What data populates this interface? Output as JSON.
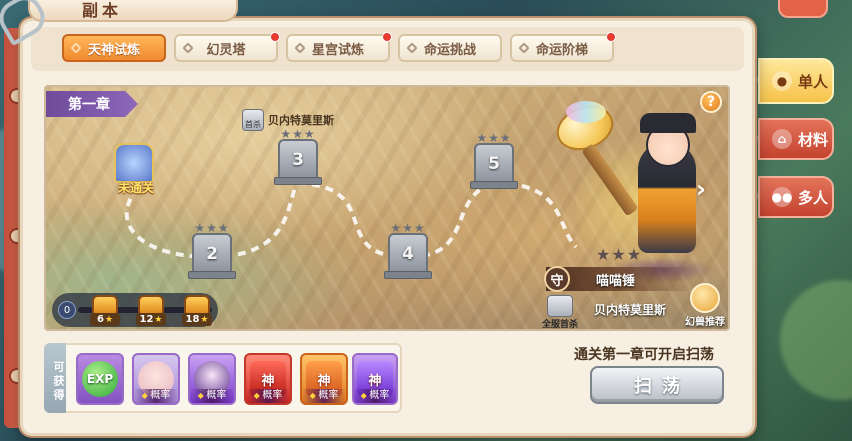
{
  "window": {
    "title": "副本"
  },
  "tabs": [
    {
      "label": "天神试炼",
      "active": true,
      "red_dot": false
    },
    {
      "label": "幻灵塔",
      "active": false,
      "red_dot": true
    },
    {
      "label": "星宫试炼",
      "active": false,
      "red_dot": true
    },
    {
      "label": "命运挑战",
      "active": false,
      "red_dot": false
    },
    {
      "label": "命运阶梯",
      "active": false,
      "red_dot": true
    }
  ],
  "map": {
    "chapter": "第一章",
    "help_symbol": "?",
    "first_kill_name": "贝内特莫里斯",
    "first_kill_badge": "首杀",
    "current_stage_label": "未通关",
    "stages": [
      "2",
      "3",
      "4",
      "5"
    ],
    "next_arrow": "›"
  },
  "boss": {
    "guard_badge": "守",
    "name": "喵喵锤",
    "stars": "★★★",
    "all_kill_label": "全服首杀",
    "recommended_player": "贝内特莫里斯",
    "pet_recommend": "幻兽推荐"
  },
  "progress": {
    "current": "0",
    "chests": [
      {
        "req": "6"
      },
      {
        "req": "12"
      },
      {
        "req": "18"
      }
    ]
  },
  "side_tabs": [
    {
      "label": "单人",
      "icon": "person-icon",
      "active": true
    },
    {
      "label": "材料",
      "icon": "material-bag-icon",
      "active": false
    },
    {
      "label": "多人",
      "icon": "group-icon",
      "active": false
    }
  ],
  "rewards": {
    "label": "可获得",
    "items": [
      {
        "kind": "exp",
        "icon": "exp-orb-icon",
        "text": "EXP",
        "tag": ""
      },
      {
        "kind": "character",
        "icon": "character-portrait-icon",
        "text": "",
        "tag": "概率"
      },
      {
        "kind": "character",
        "icon": "character-portrait-icon",
        "text": "",
        "tag": "概率"
      },
      {
        "kind": "shen-card",
        "icon": "shen-card-icon",
        "text": "神",
        "tag": "概率"
      },
      {
        "kind": "shen-card",
        "icon": "shen-card-icon",
        "text": "神",
        "tag": "概率"
      },
      {
        "kind": "shen-card",
        "icon": "shen-card-icon",
        "text": "神",
        "tag": "概率"
      }
    ]
  },
  "sweep": {
    "hint": "通关第一章可开启扫荡",
    "button_label": "扫荡"
  },
  "colors": {
    "active_tab": "#f08a2e",
    "red_dot": "#e63a2e",
    "side_active": "#f5c34a",
    "side_inactive": "#c4432f",
    "chapter_label": "#6f4b9a",
    "panel_bg": "#f6efe2"
  }
}
